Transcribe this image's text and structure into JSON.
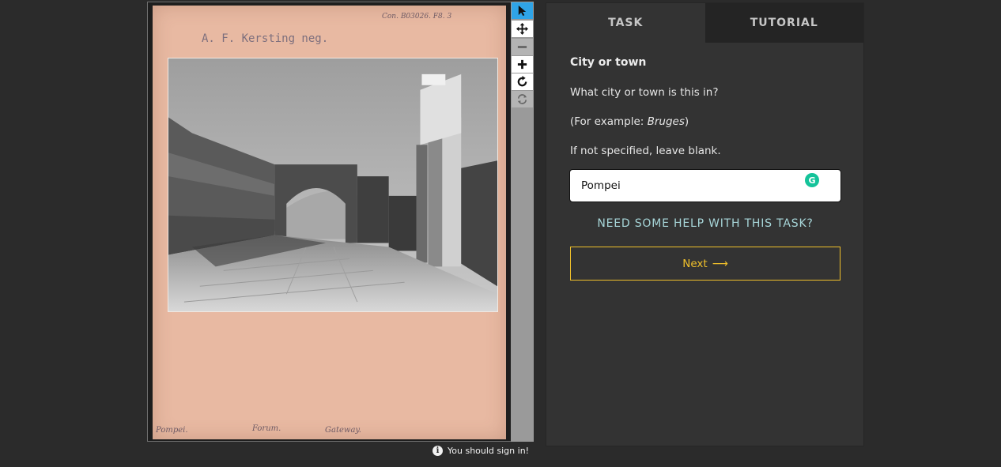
{
  "subject": {
    "stamp": "A. F. Kersting neg.",
    "ref": "Con. B03026. F8. 3",
    "caption_left": "Pompei.",
    "caption_mid": "Forum.",
    "caption_right": "Gateway."
  },
  "toolbar": {
    "tools": [
      {
        "name": "pointer-tool",
        "icon": "cursor-arrow-icon",
        "active": true
      },
      {
        "name": "move-tool",
        "icon": "move-arrows-icon"
      },
      {
        "name": "zoom-out",
        "icon": "minus-icon",
        "disabled": true
      },
      {
        "name": "zoom-in",
        "icon": "plus-icon"
      },
      {
        "name": "rotate",
        "icon": "rotate-icon"
      },
      {
        "name": "reset",
        "icon": "refresh-icon",
        "disabled": true
      }
    ],
    "accent": "#2fa4e7"
  },
  "signin": {
    "text": "You should sign in!"
  },
  "tabs": {
    "task": "TASK",
    "tutorial": "TUTORIAL"
  },
  "task": {
    "title": "City or town",
    "question": "What city or town is this in?",
    "example_prefix": "(For example: ",
    "example_value": "Bruges",
    "example_suffix": ")",
    "hint": "If not specified, leave blank.",
    "answer_value": "Pompei",
    "help_link": "NEED SOME HELP WITH THIS TASK?",
    "next_label": "Next"
  },
  "colors": {
    "background": "#2b2b2b",
    "panel": "#333333",
    "help_link": "#a7d6d9",
    "next_button": "#f0c02b"
  }
}
